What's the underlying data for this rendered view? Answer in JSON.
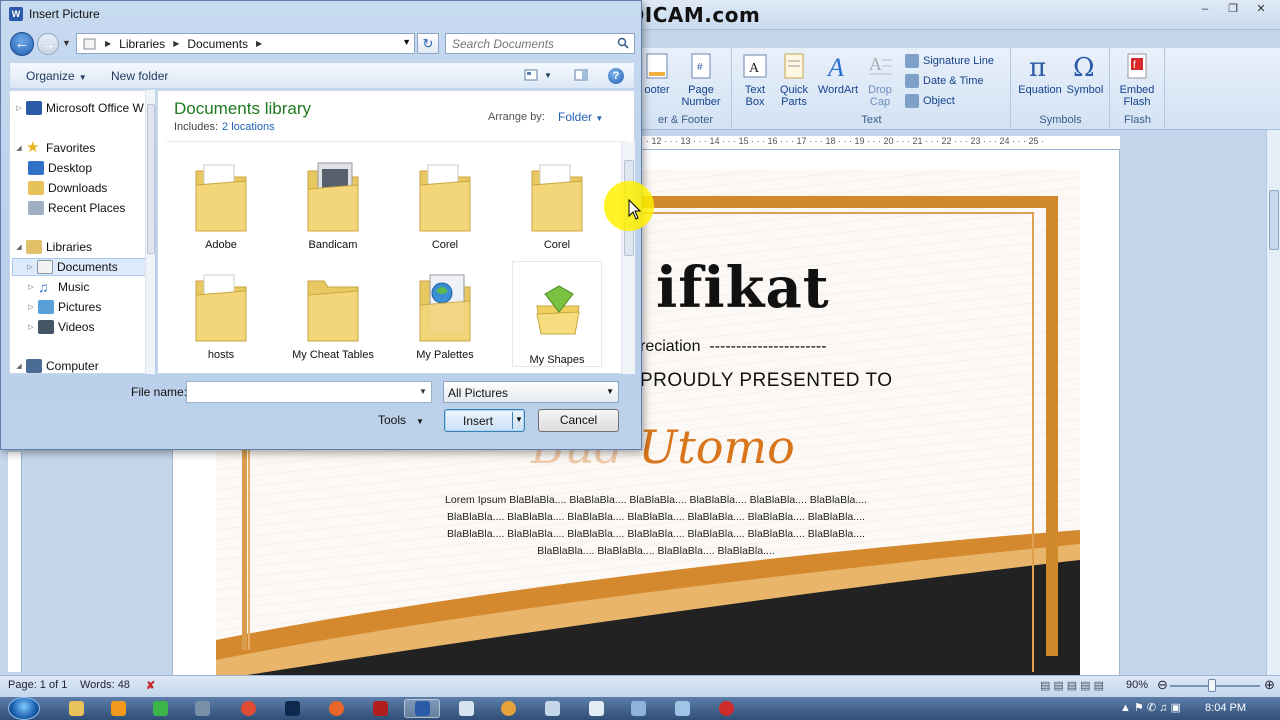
{
  "watermark": "www.BANDICAM.com",
  "word": {
    "ribbon": {
      "groups": [
        {
          "label": "er & Footer",
          "buttons": [
            {
              "label": "ooter"
            },
            {
              "label": "Page Number"
            }
          ]
        },
        {
          "label": "Text",
          "buttons": [
            {
              "label": "Text Box"
            },
            {
              "label": "Quick Parts"
            },
            {
              "label": "WordArt"
            },
            {
              "label": "Drop Cap"
            }
          ],
          "small": [
            "Signature Line",
            "Date & Time",
            "Object"
          ]
        },
        {
          "label": "Symbols",
          "buttons": [
            {
              "label": "Equation"
            },
            {
              "label": "Symbol"
            }
          ]
        },
        {
          "label": "Flash",
          "buttons": [
            {
              "label": "Embed Flash"
            }
          ]
        }
      ]
    },
    "ruler_ticks": "· 12 · · · 13 · · · 14 · · · 15 · · · 16 · · · 17 · · · 18 · · · 19 · · · 20 · · · 21 · · · 22 · · · 23 · · · 24 · · · 25 ·",
    "certificate": {
      "title": "ifikat",
      "appreciation": "reciation  ----------------------",
      "presented": "PROUDLY PRESENTED TO",
      "name_faded": "Bud",
      "name": "Utomo",
      "body": "Lorem Ipsum BlaBlaBla....  BlaBlaBla....  BlaBlaBla....  BlaBlaBla....  BlaBlaBla....  BlaBlaBla.... BlaBlaBla....  BlaBlaBla....  BlaBlaBla....  BlaBlaBla....  BlaBlaBla....  BlaBlaBla....  BlaBlaBla.... BlaBlaBla....  BlaBlaBla....  BlaBlaBla....  BlaBlaBla....  BlaBlaBla....  BlaBlaBla....  BlaBlaBla.... BlaBlaBla....  BlaBlaBla....  BlaBlaBla....  BlaBlaBla...."
    },
    "status": {
      "page": "Page: 1 of 1",
      "words": "Words: 48",
      "zoom": "90%"
    }
  },
  "taskbar": {
    "clock": "8:04 PM",
    "apps": [
      "explorer",
      "media",
      "corel",
      "scissors",
      "chrome",
      "photoshop",
      "firefox",
      "acrobat",
      "word",
      "notepad",
      "paint",
      "files",
      "window",
      "screen",
      "folder",
      "bandicam"
    ]
  },
  "dialog": {
    "title": "Insert Picture",
    "breadcrumbs": [
      "Libraries",
      "Documents"
    ],
    "search_placeholder": "Search Documents",
    "organize": "Organize",
    "new_folder": "New folder",
    "nav_items": [
      {
        "label": "Microsoft Office W",
        "icon": "word-icon"
      },
      {
        "label": "Favorites",
        "icon": "star-icon"
      },
      {
        "label": "Desktop",
        "icon": "desktop-icon"
      },
      {
        "label": "Downloads",
        "icon": "downloads-icon"
      },
      {
        "label": "Recent Places",
        "icon": "recent-places-icon"
      },
      {
        "label": "Libraries",
        "icon": "libraries-icon"
      },
      {
        "label": "Documents",
        "icon": "documents-icon"
      },
      {
        "label": "Music",
        "icon": "music-icon"
      },
      {
        "label": "Pictures",
        "icon": "pictures-icon"
      },
      {
        "label": "Videos",
        "icon": "videos-icon"
      },
      {
        "label": "Computer",
        "icon": "computer-icon"
      }
    ],
    "library_title": "Documents library",
    "includes_label": "Includes:",
    "includes_link": "2 locations",
    "arrange_label": "Arrange by:",
    "arrange_value": "Folder",
    "files": [
      {
        "name": "Adobe",
        "icon": "folder-icon"
      },
      {
        "name": "Bandicam",
        "icon": "folder-icon"
      },
      {
        "name": "Corel",
        "icon": "folder-icon"
      },
      {
        "name": "Corel",
        "icon": "folder-icon"
      },
      {
        "name": "hosts",
        "icon": "folder-icon"
      },
      {
        "name": "My Cheat Tables",
        "icon": "folder-icon"
      },
      {
        "name": "My Palettes",
        "icon": "folder-icon"
      },
      {
        "name": "My Shapes",
        "icon": "shapes-folder-icon"
      }
    ],
    "filename_label": "File name:",
    "filename_value": "",
    "filetype": "All Pictures",
    "tools": "Tools",
    "insert": "Insert",
    "cancel": "Cancel"
  }
}
